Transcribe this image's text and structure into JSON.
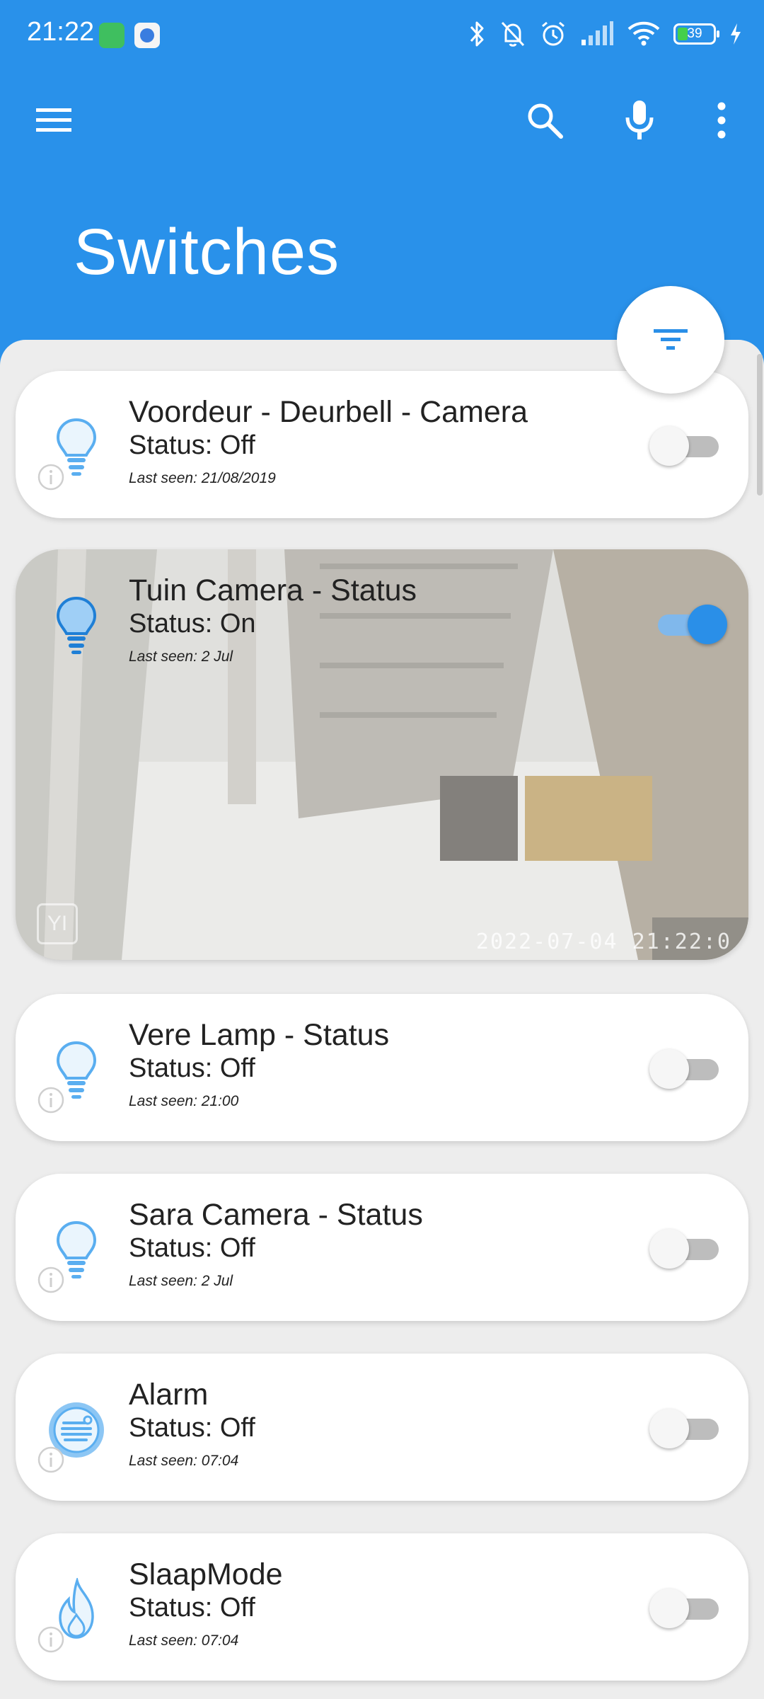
{
  "status_bar": {
    "time": "21:22",
    "battery_percent": "39",
    "icons": [
      "app-notification-icon",
      "app-notification-icon",
      "bluetooth-icon",
      "bell-off-icon",
      "alarm-clock-icon",
      "signal-icon",
      "wifi-icon",
      "battery-icon",
      "charging-bolt-icon"
    ]
  },
  "toolbar": {
    "menu_icon": "hamburger-menu-icon",
    "search_icon": "search-icon",
    "mic_icon": "microphone-icon",
    "more_icon": "more-vert-icon"
  },
  "page": {
    "title": "Switches"
  },
  "fab": {
    "icon": "filter-icon"
  },
  "colors": {
    "primary": "#2991ea",
    "accent": "#2a8fe8",
    "card": "#ffffff",
    "background": "#ededed",
    "icon_blue": "#5aaef0"
  },
  "switches": [
    {
      "title": "Voordeur - Deurbell - Camera",
      "status": "Status: Off",
      "last_seen": "Last seen: 21/08/2019",
      "on": false,
      "icon": "lightbulb-icon"
    },
    {
      "title": "Tuin Camera - Status",
      "status": "Status: On",
      "last_seen": "Last seen: 2 Jul",
      "on": true,
      "icon": "lightbulb-icon",
      "camera_timestamp": "2022-07-04 21:22:0",
      "camera_logo": "YI"
    },
    {
      "title": "Vere Lamp - Status",
      "status": "Status: Off",
      "last_seen": "Last seen: 21:00",
      "on": false,
      "icon": "lightbulb-icon"
    },
    {
      "title": "Sara Camera - Status",
      "status": "Status: Off",
      "last_seen": "Last seen: 2 Jul",
      "on": false,
      "icon": "lightbulb-icon"
    },
    {
      "title": "Alarm",
      "status": "Status: Off",
      "last_seen": "Last seen: 07:04",
      "on": false,
      "icon": "alarm-device-icon"
    },
    {
      "title": "SlaapMode",
      "status": "Status: Off",
      "last_seen": "Last seen: 07:04",
      "on": false,
      "icon": "flame-icon"
    }
  ]
}
